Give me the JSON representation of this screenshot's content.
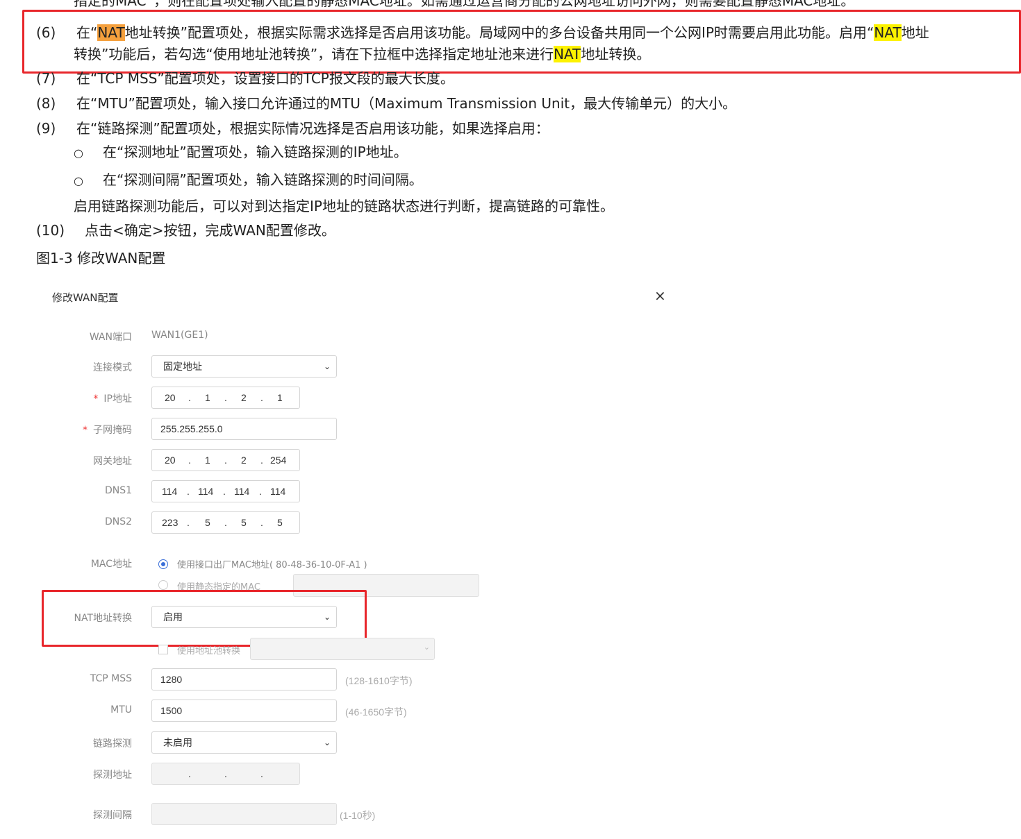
{
  "doc": {
    "top_cut_line": "指定的MAC”，则在配置项处输入配置的静态MAC地址。如需通过运营商分配的公网地址访问外网，则需要配置静态MAC地址。",
    "step6": {
      "num": "(6)",
      "line1_a": "在“",
      "line1_nat1": "NAT",
      "line1_b": "地址转换”配置项处，根据实际需求选择是否启用该功能。局域网中的多台设备共用同一个公网IP时需要启用此功能。启用“",
      "line1_nat2": "NAT",
      "line1_c": "地址",
      "line2_a": "转换”功能后，若勾选“使用地址池转换”，请在下拉框中选择指定地址池来进行",
      "line2_nat": "NAT",
      "line2_b": "地址转换。"
    },
    "step7": {
      "num": "(7)",
      "text": "在“TCP MSS”配置项处，设置接口的TCP报文段的最大长度。"
    },
    "step8": {
      "num": "(8)",
      "text": "在“MTU”配置项处，输入接口允许通过的MTU（Maximum Transmission Unit，最大传输单元）的大小。"
    },
    "step9": {
      "num": "(9)",
      "text": "在“链路探测”配置项处，根据实际情况选择是否启用该功能，如果选择启用："
    },
    "bullets": [
      {
        "mark": "○",
        "text": "在“探测地址”配置项处，输入链路探测的IP地址。"
      },
      {
        "mark": "○",
        "text": "在“探测间隔”配置项处，输入链路探测的时间间隔。"
      }
    ],
    "step9_note": "启用链路探测功能后，可以对到达指定IP地址的链路状态进行判断，提高链路的可靠性。",
    "step10": {
      "num": "(10)",
      "text": "点击<确定>按钮，完成WAN配置修改。"
    },
    "figure_caption": "图1-3 修改WAN配置"
  },
  "dialog": {
    "title": "修改WAN配置",
    "close": "×",
    "wan_port": {
      "label": "WAN端口",
      "value": "WAN1(GE1)"
    },
    "conn_mode": {
      "label": "连接模式",
      "value": "固定地址"
    },
    "ip": {
      "label": "IP地址",
      "octets": [
        "20",
        "1",
        "2",
        "1"
      ]
    },
    "mask": {
      "label": "子网掩码",
      "value": "255.255.255.0"
    },
    "gateway": {
      "label": "网关地址",
      "octets": [
        "20",
        "1",
        "2",
        "254"
      ]
    },
    "dns1": {
      "label": "DNS1",
      "octets": [
        "114",
        "114",
        "114",
        "114"
      ]
    },
    "dns2": {
      "label": "DNS2",
      "octets": [
        "223",
        "5",
        "5",
        "5"
      ]
    },
    "mac": {
      "label": "MAC地址",
      "opt1": "使用接口出厂MAC地址( 80-48-36-10-0F-A1 )",
      "opt2": "使用静态指定的MAC"
    },
    "nat": {
      "label": "NAT地址转换",
      "value": "启用",
      "pool_label": "使用地址池转换"
    },
    "tcp_mss": {
      "label": "TCP MSS",
      "value": "1280",
      "hint": "(128-1610字节)"
    },
    "mtu": {
      "label": "MTU",
      "value": "1500",
      "hint": "(46-1650字节)"
    },
    "probe": {
      "label": "链路探测",
      "value": "未启用"
    },
    "probe_addr": {
      "label": "探测地址"
    },
    "probe_interval": {
      "label": "探测间隔",
      "hint": "(1-10秒)"
    },
    "required_mark": "*",
    "ip_dot": ".",
    "chevron": "⌄"
  },
  "colors": {
    "highlight_box": "#e8262b",
    "nat_orange": "#f5a03d",
    "nat_yellow": "#fdf200",
    "radio": "#3a6fd8"
  }
}
